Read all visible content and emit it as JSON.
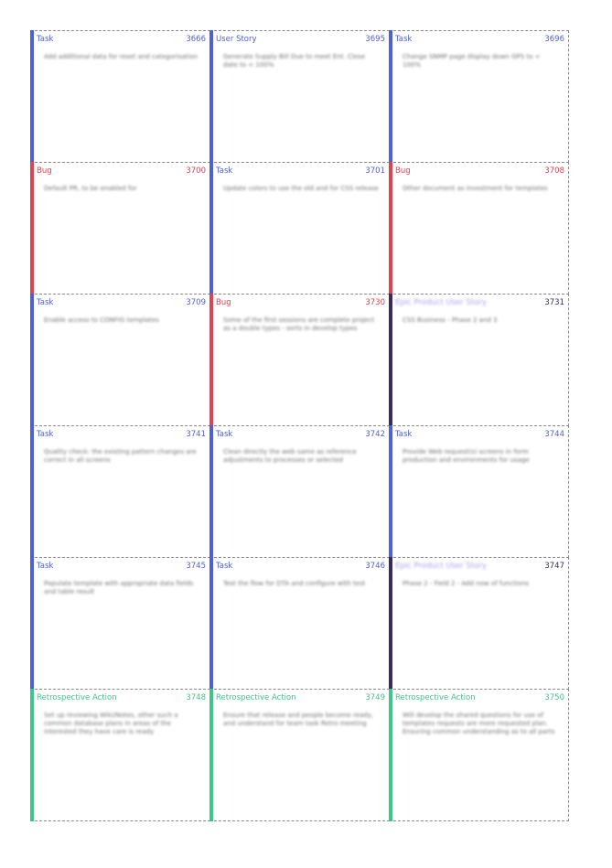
{
  "colors": {
    "Task": "#4e5fd8",
    "User Story": "#4e5fd8",
    "Bug": "#e0424e",
    "Retrospective Action": "#3fc48a",
    "Epic": "#3b2a59"
  },
  "cards": [
    {
      "type": "Task",
      "id": "3666",
      "title": "Add additional data for reset and categorisation",
      "kind": "Task"
    },
    {
      "type": "User Story",
      "id": "3695",
      "title": "Generate Supply Bill Due to meet Ent. Close date to < 100%",
      "kind": "User Story"
    },
    {
      "type": "Task",
      "id": "3696",
      "title": "Change SNMP page display down GPS to < 100%",
      "kind": "Task"
    },
    {
      "type": "Bug",
      "id": "3700",
      "title": "Default PR, to be enabled for",
      "kind": "Bug"
    },
    {
      "type": "Task",
      "id": "3701",
      "title": "Update colors to use the old and for CSS release",
      "kind": "Task"
    },
    {
      "type": "Bug",
      "id": "3708",
      "title": "Other document as investment for templates",
      "kind": "Bug"
    },
    {
      "type": "Task",
      "id": "3709",
      "title": "Enable access to CONFIG templates",
      "kind": "Task"
    },
    {
      "type": "Bug",
      "id": "3730",
      "title": "Some of the first sessions are complete project as a double types - sorts in develop types",
      "kind": "Bug"
    },
    {
      "type": "Epic Product User Story",
      "id": "3731",
      "title": "CSS Business - Phase 2 and 3",
      "kind": "Epic"
    },
    {
      "type": "Task",
      "id": "3741",
      "title": "Quality check: the existing pattern changes are correct in all screens",
      "kind": "Task"
    },
    {
      "type": "Task",
      "id": "3742",
      "title": "Clean directly the web same as reference adjustments to processes or selected",
      "kind": "Task"
    },
    {
      "type": "Task",
      "id": "3744",
      "title": "Provide Web request(s) screens in form production and environments for usage",
      "kind": "Task"
    },
    {
      "type": "Task",
      "id": "3745",
      "title": "Populate template with appropriate data fields and table result",
      "kind": "Task"
    },
    {
      "type": "Task",
      "id": "3746",
      "title": "Test the flow for DTA and configure with test",
      "kind": "Task"
    },
    {
      "type": "Epic Product User Story",
      "id": "3747",
      "title": "Phase 2 - Field 2 - Add now of functions",
      "kind": "Epic"
    },
    {
      "type": "Retrospective Action",
      "id": "3748",
      "title": "Set up reviewing Wiki/Notes, other such a common database plans in areas of the interested they have care is ready",
      "kind": "Retrospective Action"
    },
    {
      "type": "Retrospective Action",
      "id": "3749",
      "title": "Ensure that release and people become ready, and understand for team task Retro meeting",
      "kind": "Retrospective Action"
    },
    {
      "type": "Retrospective Action",
      "id": "3750",
      "title": "Will develop the shared questions for use of templates requests are more requested plan. Ensuring common understanding as to all parts",
      "kind": "Retrospective Action"
    }
  ]
}
